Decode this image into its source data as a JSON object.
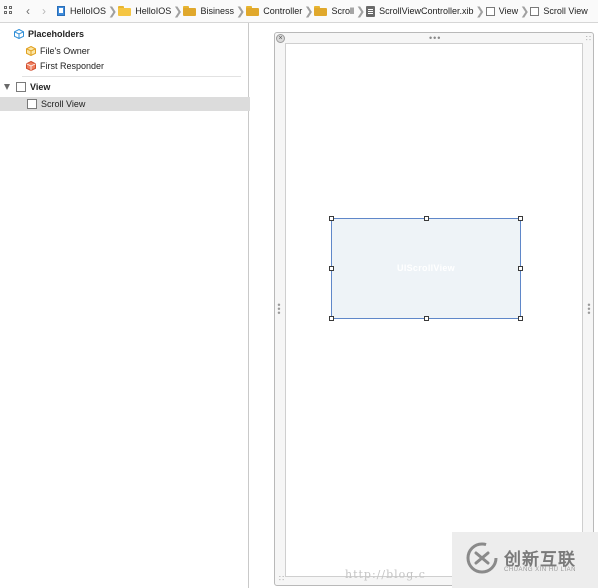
{
  "jumpbar": {
    "crumbs": [
      {
        "label": "HelloIOS",
        "icon": "project-icon"
      },
      {
        "label": "HelloIOS",
        "icon": "folder-icon"
      },
      {
        "label": "Bisiness",
        "icon": "folder-icon"
      },
      {
        "label": "Controller",
        "icon": "folder-icon"
      },
      {
        "label": "Scroll",
        "icon": "folder-icon"
      },
      {
        "label": "ScrollViewController.xib",
        "icon": "xib-file-icon"
      },
      {
        "label": "View",
        "icon": "view-icon"
      },
      {
        "label": "Scroll View",
        "icon": "view-icon"
      }
    ]
  },
  "outline": {
    "placeholders_label": "Placeholders",
    "files_owner_label": "File's Owner",
    "first_responder_label": "First Responder",
    "view_label": "View",
    "scroll_view_label": "Scroll View"
  },
  "canvas": {
    "scrollview_label": "UIScrollView",
    "selection_color": "#5f87c9"
  },
  "watermark": {
    "url_text": "http://blog.c",
    "brand_cn": "创新互联",
    "brand_en": "CHUANG XIN HU LIAN"
  }
}
